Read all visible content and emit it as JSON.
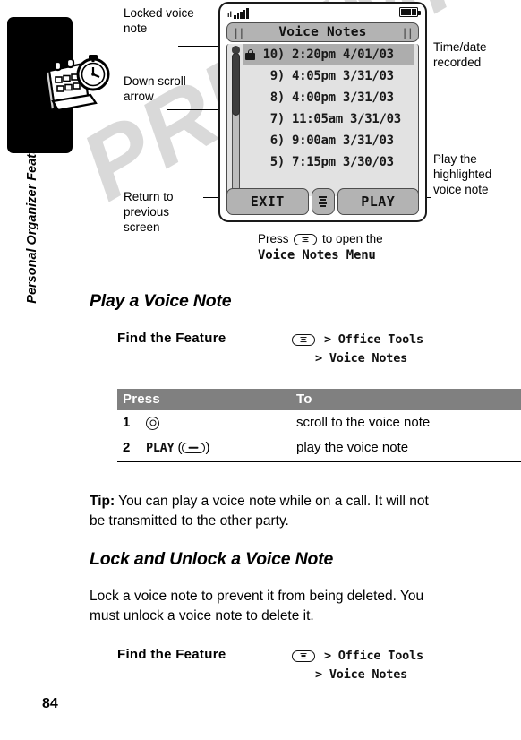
{
  "page": {
    "number": "84",
    "side_tab_label": "Personal Organizer Features",
    "watermark": "PRELIMINARY"
  },
  "callouts": {
    "locked_voice_note": "Locked voice note",
    "down_scroll_arrow": "Down scroll arrow",
    "return_previous": "Return to previous screen",
    "time_date_recorded": "Time/date recorded",
    "play_highlighted": "Play the highlighted voice note"
  },
  "phone": {
    "status": {
      "signal_icon": "signal-bars-icon",
      "battery_icon": "battery-icon",
      "battery_bars": 3
    },
    "title": "Voice Notes",
    "title_mark_left": "||",
    "title_mark_right": "||",
    "notes": [
      {
        "index": "10)",
        "meta": "2:20pm 4/01/03",
        "locked": true,
        "selected": true
      },
      {
        "index": "9)",
        "meta": "4:05pm 3/31/03",
        "locked": false,
        "selected": false
      },
      {
        "index": "8)",
        "meta": "4:00pm 3/31/03",
        "locked": false,
        "selected": false
      },
      {
        "index": "7)",
        "meta": "11:05am 3/31/03",
        "locked": false,
        "selected": false
      },
      {
        "index": "6)",
        "meta": "9:00am 3/31/03",
        "locked": false,
        "selected": false
      },
      {
        "index": "5)",
        "meta": "7:15pm 3/30/03",
        "locked": false,
        "selected": false
      }
    ],
    "softkeys": {
      "left": "EXIT",
      "center_icon": "menu-icon",
      "right": "PLAY"
    }
  },
  "press_caption": {
    "prefix": "Press",
    "key_icon": "menu-key-icon",
    "suffix": "to open the",
    "bold_line": "Voice Notes Menu"
  },
  "sections": [
    {
      "heading": "Play a Voice Note",
      "find_the_feature": {
        "label": "Find the Feature",
        "key_icon": "menu-key-icon",
        "path_line1": "> Office Tools",
        "path_line2": "> Voice Notes"
      }
    },
    {
      "heading": "Lock and Unlock a Voice Note",
      "find_the_feature": {
        "label": "Find the Feature",
        "key_icon": "menu-key-icon",
        "path_line1": "> Office Tools",
        "path_line2": "> Voice Notes"
      }
    }
  ],
  "procedure_table": {
    "headers": [
      "Press",
      "To"
    ],
    "rows": [
      {
        "num": "1",
        "key_label": "",
        "key_icon": "navigation-key-icon",
        "to": "scroll to the voice note"
      },
      {
        "num": "2",
        "key_label": "PLAY",
        "key_icon": "soft-key-icon",
        "to": "play the voice note"
      }
    ]
  },
  "paragraphs": {
    "tip_label": "Tip:",
    "tip_text": " You can play a voice note while on a call. It will not be transmitted to the other party.",
    "lock_text": "Lock a voice note to prevent it from being deleted. You must unlock a voice note to delete it."
  }
}
